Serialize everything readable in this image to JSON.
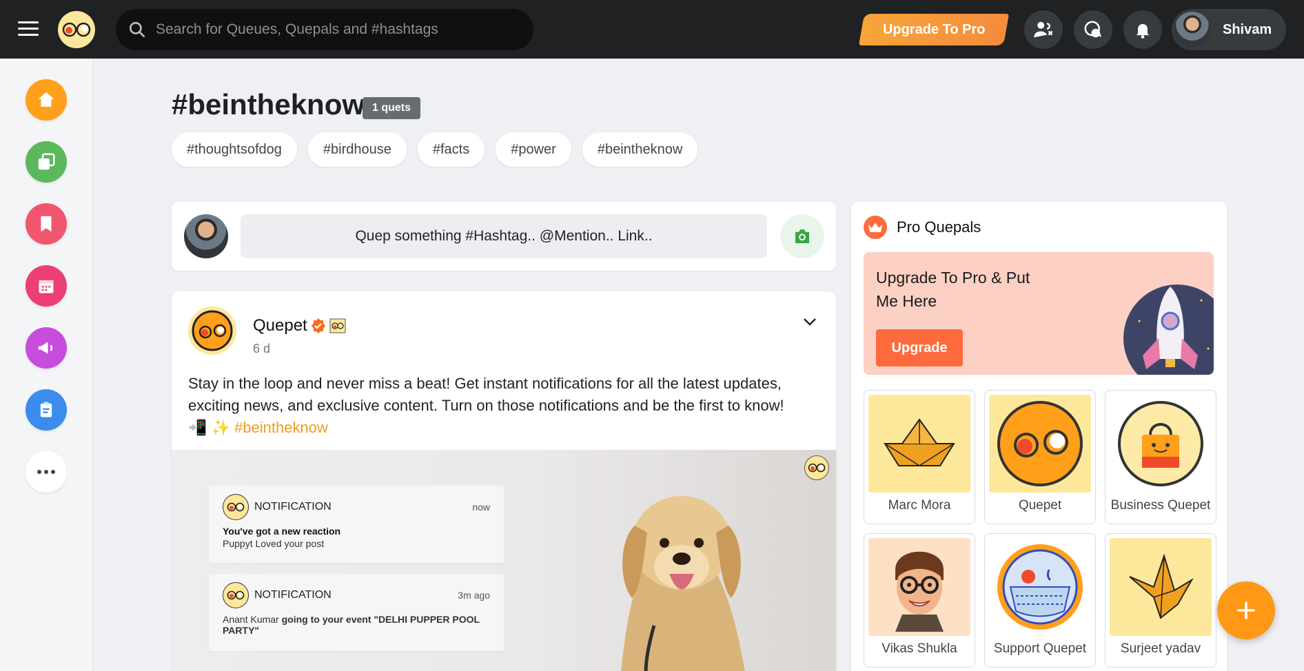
{
  "header": {
    "search_placeholder": "Search for Queues, Quepals and #hashtags",
    "upgrade_label": "Upgrade To Pro",
    "user_name": "Shivam"
  },
  "sidebar": {
    "items": [
      {
        "icon": "home-icon",
        "color": "#ff9f1a"
      },
      {
        "icon": "layers-icon",
        "color": "#5cb85c"
      },
      {
        "icon": "bookmark-icon",
        "color": "#f0566f"
      },
      {
        "icon": "calendar-icon",
        "color": "#ec3f73"
      },
      {
        "icon": "megaphone-icon",
        "color": "#c94ddc"
      },
      {
        "icon": "clipboard-icon",
        "color": "#3b8cec"
      },
      {
        "icon": "more-icon",
        "color": "#ffffff"
      }
    ]
  },
  "hashtag": {
    "title": "#beintheknow",
    "count": "1 quets",
    "related": [
      "#thoughtsofdog",
      "#birdhouse",
      "#facts",
      "#power",
      "#beintheknow"
    ]
  },
  "composer": {
    "placeholder": "Quep something #Hashtag.. @Mention.. Link.."
  },
  "post": {
    "author": "Quepet",
    "time": "6 d",
    "text": "Stay in the loop and never miss a beat! Get instant notifications for all the latest updates, exciting news, and exclusive content. Turn on those notifications and be the first to know!",
    "emoji": "📲 ✨",
    "hashtag": "#beintheknow",
    "notifications": [
      {
        "label": "NOTIFICATION",
        "time": "now",
        "title": "You've got a new reaction",
        "sub": "Puppyt Loved your post"
      },
      {
        "label": "NOTIFICATION",
        "time": "3m ago",
        "name": "Anant Kumar",
        "text": "going to your event \"DELHI PUPPER POOL PARTY\""
      }
    ]
  },
  "pro_panel": {
    "title": "Pro Quepals",
    "promo_text": "Upgrade To Pro & Put Me Here",
    "promo_button": "Upgrade",
    "quepals": [
      {
        "name": "Marc Mora",
        "bg": "#fde79a"
      },
      {
        "name": "Quepet",
        "bg": "#fde79a"
      },
      {
        "name": "Business Quepet",
        "bg": "#ffffff"
      },
      {
        "name": "Vikas Shukla",
        "bg": "#fde1c4"
      },
      {
        "name": "Support Quepet",
        "bg": "#ffffff"
      },
      {
        "name": "Surjeet yadav",
        "bg": "#fde79a"
      }
    ]
  },
  "colors": {
    "accent": "#ff9814",
    "topbar": "#1f2122",
    "promo_bg": "#fdd0c4"
  }
}
